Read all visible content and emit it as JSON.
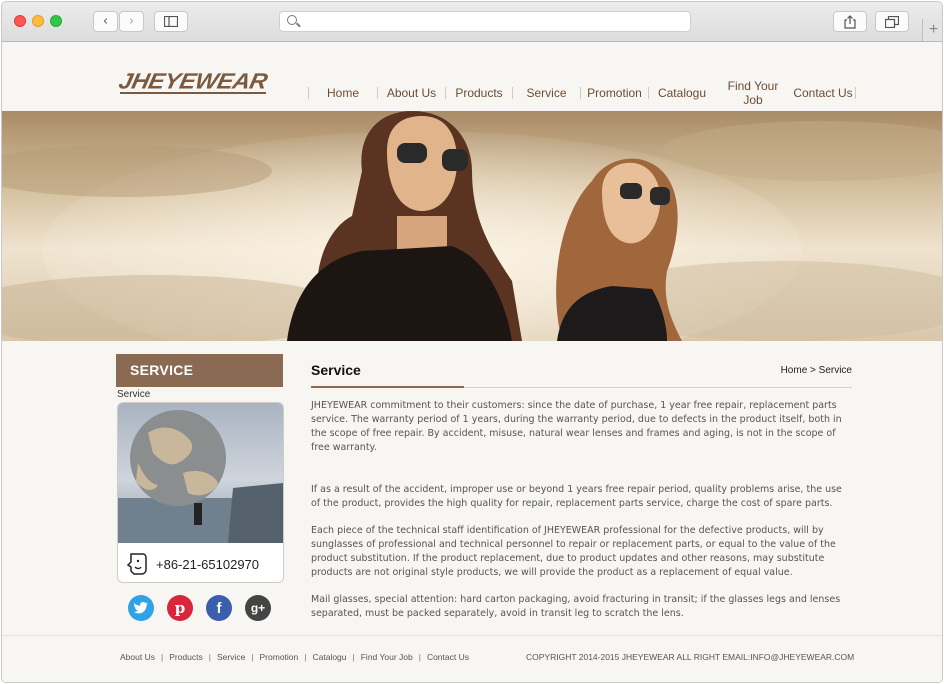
{
  "colors": {
    "brand": "#7a5b40",
    "sidebar_title_bg": "#8a6a52",
    "page_bg": "#f8f6f3",
    "twitter": "#2fa3e6",
    "pinterest": "#d8263a",
    "facebook": "#3b5fae",
    "google_plus": "#444444"
  },
  "logo": {
    "text": "JHEYEWEAR"
  },
  "nav": {
    "items": [
      {
        "label": "Home"
      },
      {
        "label": "About Us"
      },
      {
        "label": "Products"
      },
      {
        "label": "Service"
      },
      {
        "label": "Promotion"
      },
      {
        "label": "Catalogu"
      },
      {
        "label": "Find Your Job"
      },
      {
        "label": "Contact Us"
      }
    ]
  },
  "sidebar": {
    "title": "SERVICE",
    "subtitle": "Service",
    "phone": "+86-21-65102970",
    "social": [
      {
        "icon": "twitter-icon"
      },
      {
        "icon": "pinterest-icon"
      },
      {
        "icon": "facebook-icon"
      },
      {
        "icon": "google-plus-icon"
      }
    ]
  },
  "main": {
    "title": "Service",
    "breadcrumb": "Home > Service",
    "paragraphs": [
      "JHEYEWEAR commitment to their customers: since the date of purchase, 1 year free repair, replacement parts service. The warranty period of 1 years, during the warranty period, due to defects in the product itself, both in the scope of free repair. By accident, misuse, natural wear lenses and frames and aging, is not in the scope of free warranty.",
      "If as a result of the accident, improper use or beyond 1 years free repair period, quality problems arise, the use of the product, provides the high quality for repair, replacement parts service, charge the cost of spare parts.",
      "Each piece of the technical staff identification of JHEYEWEAR professional for the defective products, will by sunglasses of professional and technical personnel to repair or replacement parts, or equal to the value of the product substitution. If the product replacement, due to product updates and other reasons, may substitute products are not original style products, we will provide the product as a replacement of equal value.",
      "Mail glasses, special attention: hard carton packaging, avoid fracturing in transit; if the glasses legs and lenses separated, must be packed separately, avoid in transit leg to scratch the lens."
    ]
  },
  "footer": {
    "links": [
      {
        "label": "About Us"
      },
      {
        "label": "Products"
      },
      {
        "label": "Service"
      },
      {
        "label": "Promotion"
      },
      {
        "label": "Catalogu"
      },
      {
        "label": "Find Your Job"
      },
      {
        "label": "Contact Us"
      }
    ],
    "copyright": "COPYRIGHT 2014-2015 JHEYEWEAR ALL RIGHT EMAIL:INFO@JHEYEWEAR.COM"
  }
}
